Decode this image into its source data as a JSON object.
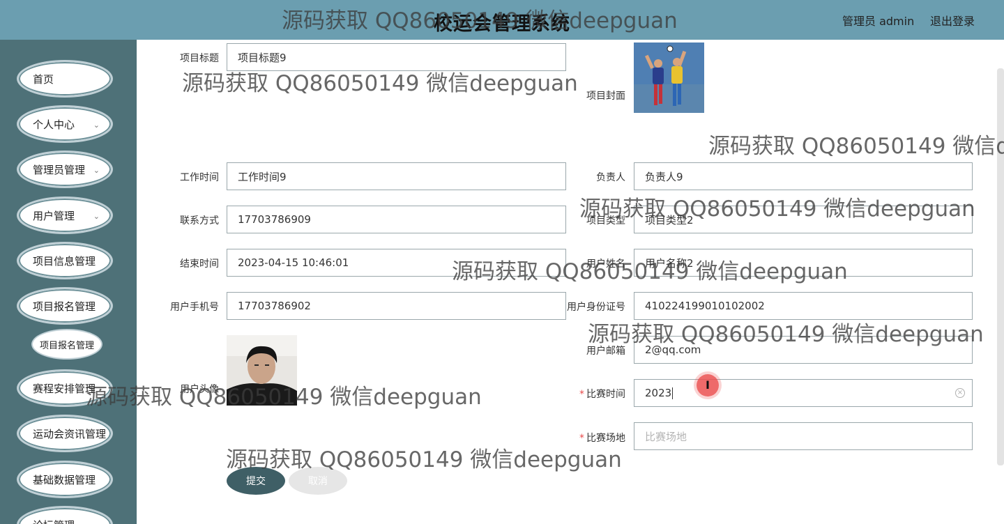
{
  "header": {
    "title": "校运会管理系统",
    "user": "管理员 admin",
    "logout": "退出登录"
  },
  "sidebar": {
    "items": [
      {
        "label": "首页",
        "chevron": false
      },
      {
        "label": "个人中心",
        "chevron": true
      },
      {
        "label": "管理员管理",
        "chevron": true
      },
      {
        "label": "用户管理",
        "chevron": true
      },
      {
        "label": "项目信息管理",
        "chevron": false
      },
      {
        "label": "项目报名管理",
        "chevron": false
      },
      {
        "label": "赛程安排管理",
        "chevron": false
      },
      {
        "label": "运动会资讯管理",
        "chevron": false
      },
      {
        "label": "基础数据管理",
        "chevron": false
      },
      {
        "label": "论坛管理",
        "chevron": true
      }
    ],
    "subitem": "项目报名管理"
  },
  "form": {
    "project_title": {
      "label": "项目标题",
      "value": "项目标题9"
    },
    "cover": {
      "label": "项目封面"
    },
    "work_time": {
      "label": "工作时间",
      "value": "工作时间9"
    },
    "person_in_charge": {
      "label": "负责人",
      "value": "负责人9"
    },
    "contact": {
      "label": "联系方式",
      "value": "17703786909"
    },
    "project_type": {
      "label": "项目类型",
      "value": "项目类型2"
    },
    "end_time": {
      "label": "结束时间",
      "value": "2023-04-15 10:46:01"
    },
    "user_name": {
      "label": "用户姓名",
      "value": "用户名称2"
    },
    "user_phone": {
      "label": "用户手机号",
      "value": "17703786902"
    },
    "user_id": {
      "label": "用户身份证号",
      "value": "410224199010102002"
    },
    "user_avatar": {
      "label": "用户头像"
    },
    "user_email": {
      "label": "用户邮箱",
      "value": "2@qq.com"
    },
    "match_time": {
      "label": "比赛时间",
      "value": "2023",
      "required": true
    },
    "match_venue": {
      "label": "比赛场地",
      "placeholder": "比赛场地",
      "required": true
    }
  },
  "buttons": {
    "submit": "提交",
    "cancel": "取消"
  },
  "click_marker_glyph": "I",
  "watermark": "源码获取 QQ86050149 微信deepguan",
  "colors": {
    "header_bg": "#6b9eb0",
    "sidebar_bg": "#4e7178",
    "submit_bg": "#3f5f66",
    "required": "#e84b4b"
  }
}
